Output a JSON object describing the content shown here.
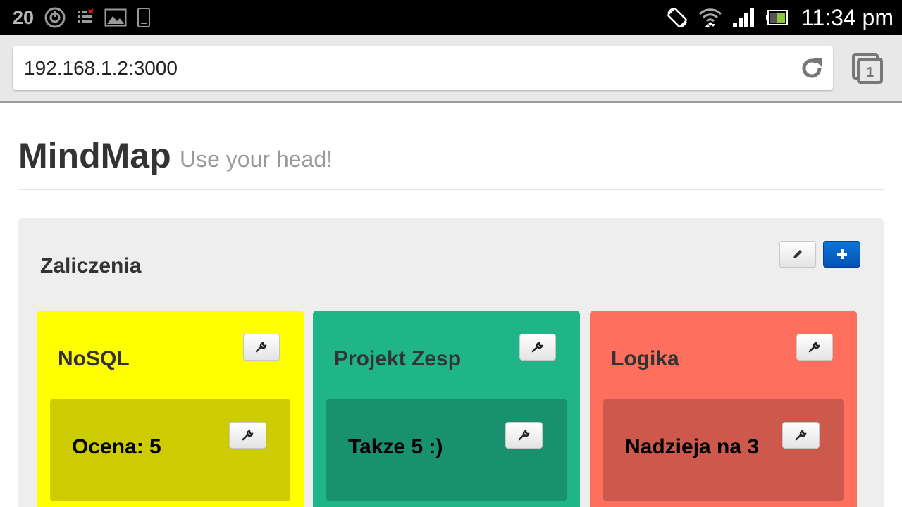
{
  "status_bar": {
    "notification_count": "20",
    "time": "11:34 pm",
    "icons": [
      "sync-icon",
      "task-icon",
      "gallery-icon",
      "phone-icon",
      "rotation-icon",
      "wifi-icon",
      "signal-icon",
      "battery-icon"
    ]
  },
  "browser": {
    "url": "192.168.1.2:3000",
    "tab_count": "1"
  },
  "header": {
    "title": "MindMap",
    "subtitle": "Use your head!"
  },
  "board": {
    "title": "Zaliczenia",
    "cards": [
      {
        "title": "NoSQL",
        "color": "#ffff00",
        "sub_color": "#cccc00",
        "item": "Ocena: 5"
      },
      {
        "title": "Projekt Zesp",
        "color": "#1fb587",
        "sub_color": "#19916c",
        "item": "Takze 5 :)"
      },
      {
        "title": "Logika",
        "color": "#ff6f5e",
        "sub_color": "#cc594b",
        "item": "Nadzieja na 3"
      }
    ]
  },
  "colors": {
    "primary_button": "#0663c7"
  }
}
